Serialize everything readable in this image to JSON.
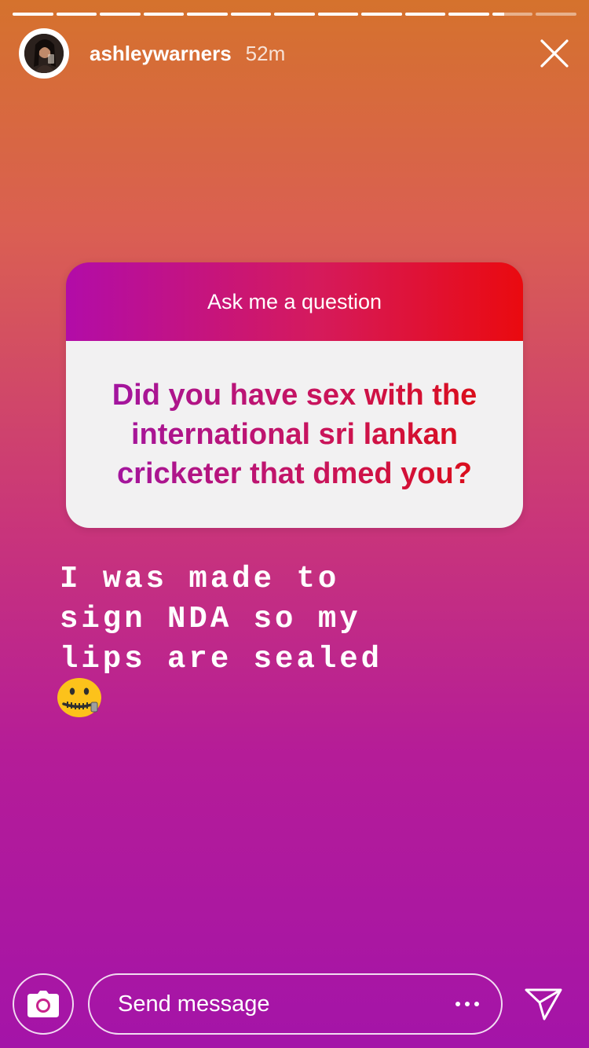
{
  "story": {
    "segments": 13,
    "current_segment": 11,
    "current_progress": 0.3
  },
  "header": {
    "username": "ashleywarners",
    "time": "52m",
    "avatar_icon": "profile-photo",
    "close_icon": "close-icon"
  },
  "question_sticker": {
    "prompt": "Ask me a question",
    "question": "Did you have sex with the international sri lankan cricketer that dmed you?"
  },
  "answer": {
    "lines": [
      "I was made to",
      "sign NDA so my",
      "lips are sealed"
    ],
    "emoji": "zipper-mouth-face"
  },
  "footer": {
    "message_placeholder": "Send message",
    "camera_icon": "camera-icon",
    "more_icon": "more-dots-icon",
    "send_icon": "send-icon"
  },
  "colors": {
    "gradient_top": "#d5722d",
    "gradient_bottom": "#a414a8",
    "sticker_left": "#b20ca8",
    "sticker_right": "#ea0a0f"
  }
}
